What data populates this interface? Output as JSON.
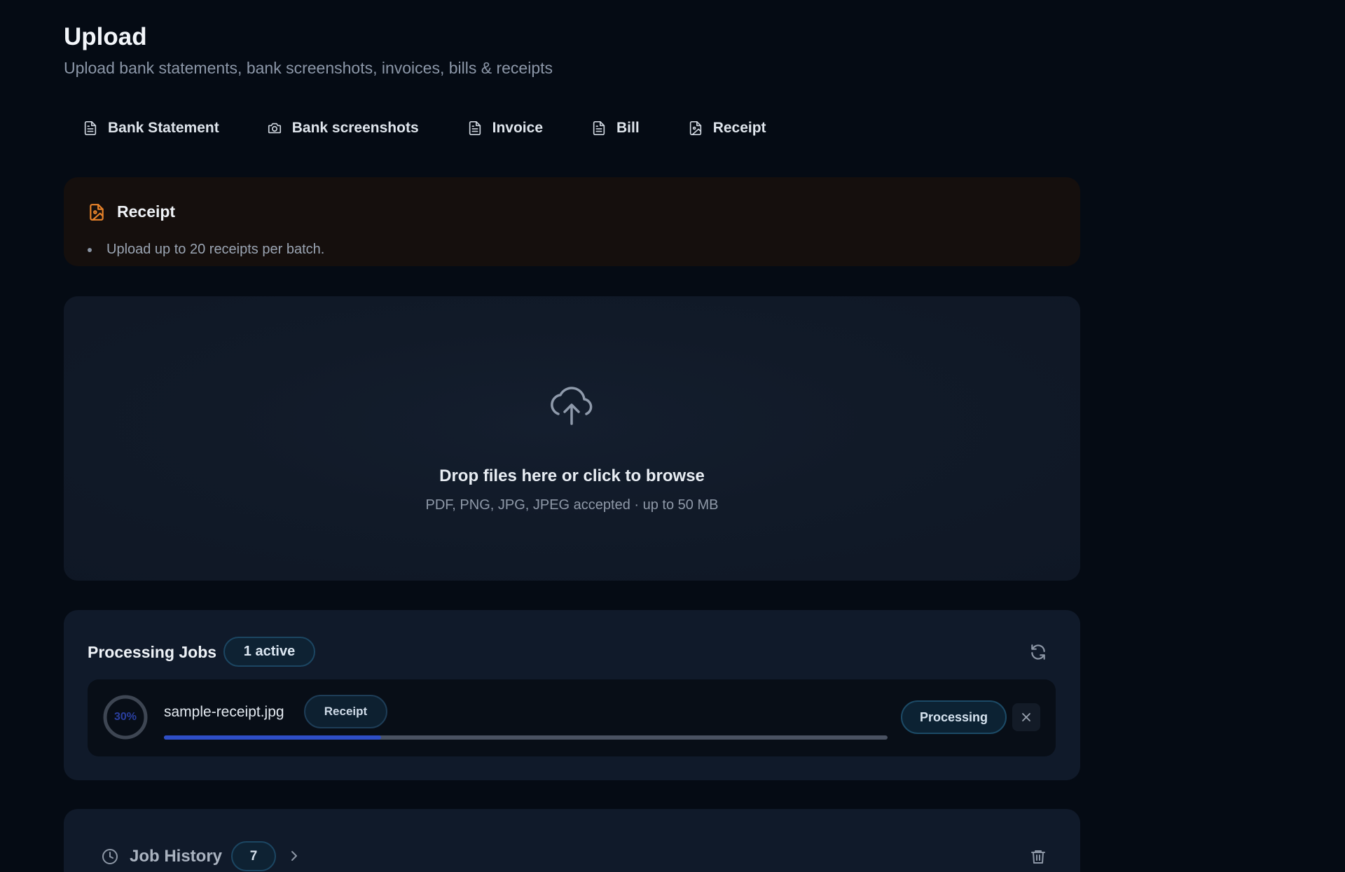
{
  "page": {
    "title": "Upload",
    "subtitle": "Upload bank statements, bank screenshots, invoices, bills & receipts"
  },
  "tabs": [
    {
      "label": "Bank Statement",
      "icon": "file-text-icon"
    },
    {
      "label": "Bank screenshots",
      "icon": "camera-icon"
    },
    {
      "label": "Invoice",
      "icon": "file-text-icon"
    },
    {
      "label": "Bill",
      "icon": "file-text-icon"
    },
    {
      "label": "Receipt",
      "icon": "file-image-icon"
    }
  ],
  "info_box": {
    "title": "Receipt",
    "icon": "file-image-icon",
    "bullets": [
      "Upload up to 20 receipts per batch."
    ],
    "accent_color": "#e8832a"
  },
  "dropzone": {
    "icon": "cloud-upload-icon",
    "title": "Drop files here or click to browse",
    "subtitle": "PDF, PNG, JPG, JPEG accepted · up to 50 MB"
  },
  "processing_jobs": {
    "title": "Processing Jobs",
    "active_badge": "1 active",
    "jobs": [
      {
        "progress_label": "30%",
        "progress": 0.3,
        "file_name": "sample-receipt.jpg",
        "type": "Receipt",
        "status": "Processing"
      }
    ],
    "progress_color": "#2e4ec6"
  },
  "job_history": {
    "title": "Job History",
    "count": "7"
  }
}
